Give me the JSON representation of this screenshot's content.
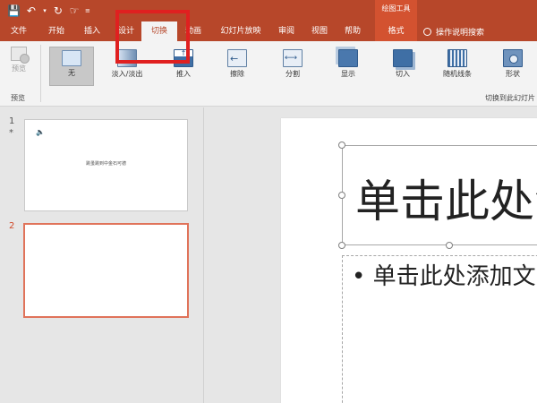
{
  "qat": {
    "save_icon": "save-icon",
    "undo_icon": "undo-icon",
    "redo_icon": "redo-icon",
    "touch_icon": "touch-mode-icon",
    "customize_icon": "customize-qat-icon"
  },
  "context_tools": {
    "label": "绘图工具"
  },
  "tabs": {
    "file": "文件",
    "home": "开始",
    "insert": "插入",
    "design": "设计",
    "transitions": "切换",
    "animations": "动画",
    "slideshow": "幻灯片放映",
    "review": "审阅",
    "view": "视图",
    "help": "帮助",
    "format": "格式"
  },
  "tell_me": {
    "label": "操作说明搜索",
    "icon": "lightbulb-icon"
  },
  "ribbon": {
    "preview": {
      "label": "预览",
      "group_label": "预览"
    },
    "transitions": [
      {
        "label": "无",
        "icon": "none-transition-icon"
      },
      {
        "label": "淡入/淡出",
        "icon": "fade-transition-icon"
      },
      {
        "label": "推入",
        "icon": "push-transition-icon"
      },
      {
        "label": "擦除",
        "icon": "wipe-transition-icon"
      },
      {
        "label": "分割",
        "icon": "split-transition-icon"
      },
      {
        "label": "显示",
        "icon": "reveal-transition-icon"
      },
      {
        "label": "切入",
        "icon": "cut-transition-icon"
      },
      {
        "label": "随机线条",
        "icon": "random-bars-transition-icon"
      },
      {
        "label": "形状",
        "icon": "shape-transition-icon"
      }
    ],
    "group_label_right": "切换到此幻灯片"
  },
  "slides": [
    {
      "number": "1",
      "marker": "*",
      "text": "跳蚤跳到中金石可德",
      "icon": "speaker-icon"
    },
    {
      "number": "2"
    }
  ],
  "editor": {
    "title_placeholder": "单击此处添",
    "body_placeholder": "• 单击此处添加文"
  },
  "colors": {
    "accent": "#b7472a",
    "context_tab": "#d35230",
    "highlight": "#e02020"
  }
}
